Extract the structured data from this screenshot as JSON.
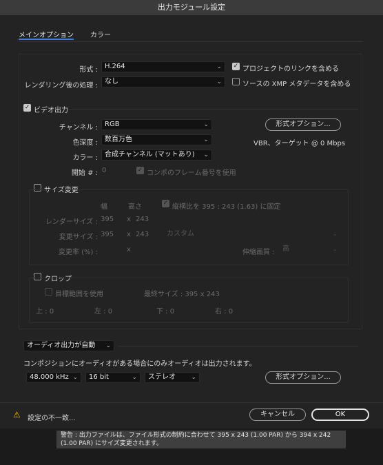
{
  "window": {
    "title": "出力モジュール設定"
  },
  "tabs": [
    {
      "label": "メインオプション"
    },
    {
      "label": "カラー"
    }
  ],
  "format": {
    "label": "形式 :",
    "value": "H.264",
    "checkbox_label": "プロジェクトのリンクを含める",
    "checked": true
  },
  "post_render": {
    "label": "レンダリング後の処理 :",
    "value": "なし",
    "checkbox_label": "ソースの XMP メタデータを含める",
    "checked": false
  },
  "video_output": {
    "label": "ビデオ出力",
    "checked": true,
    "channels_label": "チャンネル :",
    "channels_value": "RGB",
    "depth_label": "色深度 :",
    "depth_value": "数百万色",
    "color_label": "カラー :",
    "color_value": "合成チャンネル (マットあり)",
    "format_options_button": "形式オプション...",
    "summary": "VBR、ターゲット @ 0 Mbps",
    "start_label": "開始 # :",
    "start_value": "0",
    "comp_frame_label": "コンポのフレーム番号を使用"
  },
  "resize": {
    "label": "サイズ変更",
    "checked": false,
    "width_header": "幅",
    "height_header": "高さ",
    "lock_label": "縦横比を 395 : 243 (1.63) に固定",
    "render_size_label": "レンダーサイズ :",
    "render_w": "395",
    "x1": "x",
    "render_h": "243",
    "resize_to_label": "変更サイズ :",
    "resize_w": "395",
    "x2": "x",
    "resize_h": "243",
    "custom_value": "カスタム",
    "percent_label": "変更率 (%) :",
    "x3": "x",
    "quality_label": "伸縮画質 :",
    "quality_value": "高"
  },
  "crop": {
    "label": "クロップ",
    "checked": false,
    "roi_label": "目標範囲を使用",
    "final_size": "最終サイズ : 395 x 243",
    "top": "上 : 0",
    "left": "左 : 0",
    "bottom": "下 : 0",
    "right": "右 : 0"
  },
  "audio": {
    "mode": "オーディオ出力が自動",
    "note": "コンポジションにオーディオがある場合にのみオーディオは出力されます。",
    "rate": "48.000 kHz",
    "bits": "16 bit",
    "channels": "ステレオ",
    "format_options_button": "形式オプション..."
  },
  "footer": {
    "warning_text": "設定の不一致...",
    "cancel_label": "キャンセル",
    "ok_label": "OK"
  },
  "tooltip": {
    "line1": "警告 : 出力ファイルは、ファイル形式の制約に合わせて 395 x 243 (1.00 PAR) から 394 x 242",
    "line2": "(1.00 PAR) にサイズ変更されます。"
  },
  "colors": {
    "accent": "#3d7fe0",
    "background": "#232323",
    "warning": "#f0c020"
  }
}
